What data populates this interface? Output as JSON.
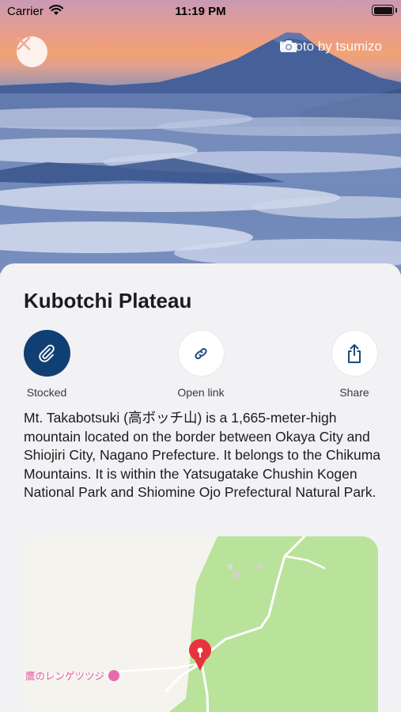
{
  "status_bar": {
    "carrier": "Carrier",
    "time": "11:19 PM"
  },
  "hero": {
    "photo_credit": "Photo by tsumizo"
  },
  "place": {
    "title": "Kubotchi Plateau",
    "description": "Mt. Takabotsuki (高ボッチ山) is a 1,665-meter-high mountain located on the border between Okaya City and Shiojiri City, Nagano Prefecture. It belongs to the Chikuma Mountains. It is within the Yatsugatake Chushin Kogen National Park and Shiomine Ojo Prefectural Natural Park."
  },
  "actions": {
    "stocked_label": "Stocked",
    "open_link_label": "Open link",
    "share_label": "Share"
  },
  "map": {
    "poi_label": "鷹のレンゲツツジ"
  },
  "colors": {
    "accent": "#103f73",
    "sheet_background": "#f2f2f4",
    "map_park": "#b9e29b",
    "map_pin": "#e8323c"
  },
  "icons": [
    "wifi-icon",
    "battery-icon",
    "close-icon",
    "camera-icon",
    "paperclip-icon",
    "link-icon",
    "share-icon",
    "map-pin-icon",
    "poi-icon"
  ]
}
